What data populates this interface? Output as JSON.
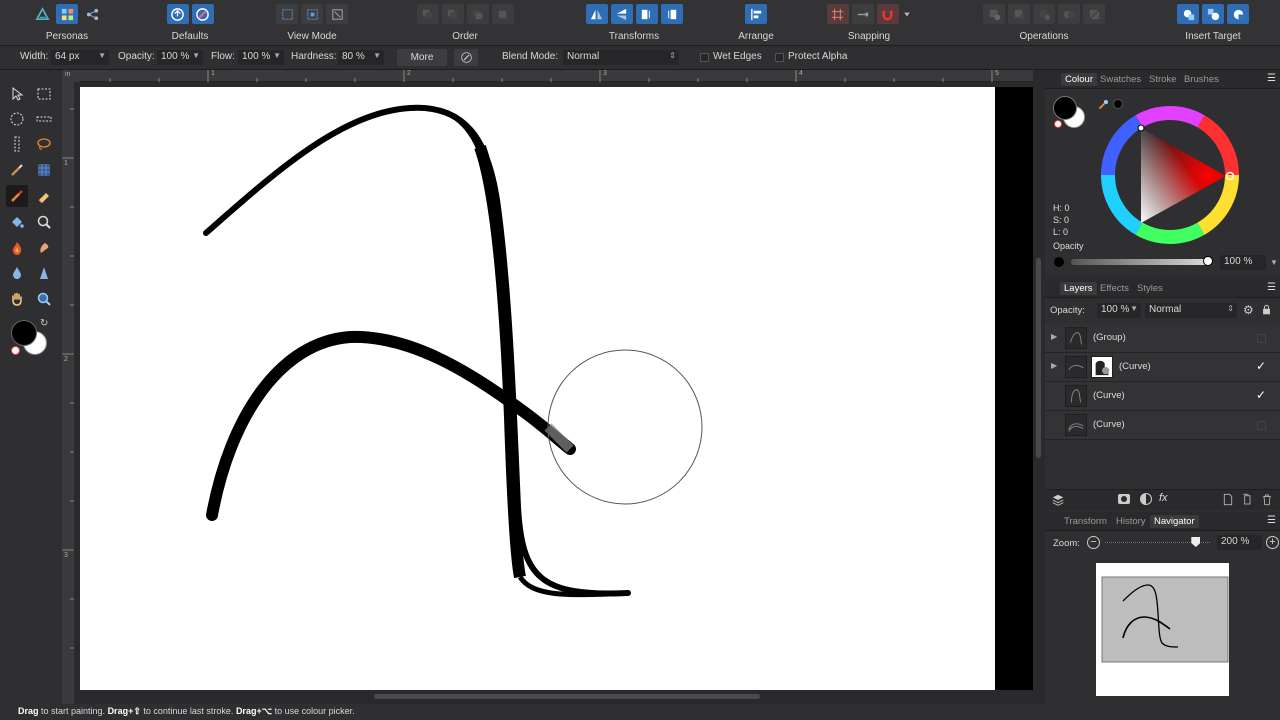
{
  "toolbar": {
    "groups": [
      {
        "label": "Personas"
      },
      {
        "label": "Defaults"
      },
      {
        "label": "View Mode"
      },
      {
        "label": "Order"
      },
      {
        "label": "Transforms"
      },
      {
        "label": "Arrange"
      },
      {
        "label": "Snapping"
      },
      {
        "label": "Operations"
      },
      {
        "label": "Insert Target"
      }
    ]
  },
  "context": {
    "width_label": "Width:",
    "width_value": "64 px",
    "opacity_label": "Opacity:",
    "opacity_value": "100 %",
    "flow_label": "Flow:",
    "flow_value": "100 %",
    "hardness_label": "Hardness:",
    "hardness_value": "80 %",
    "more_label": "More",
    "blend_label": "Blend Mode:",
    "blend_value": "Normal",
    "wet_edges_label": "Wet Edges",
    "protect_alpha_label": "Protect Alpha"
  },
  "rulers": {
    "unit": "in",
    "top_ticks": [
      "1",
      "2",
      "3",
      "4",
      "5"
    ],
    "left_ticks": [
      "1",
      "2",
      "3"
    ]
  },
  "colour_panel": {
    "tabs": [
      "Colour",
      "Swatches",
      "Stroke",
      "Brushes"
    ],
    "active_tab": "Colour",
    "h": "H: 0",
    "s": "S: 0",
    "l": "L: 0",
    "opacity_label": "Opacity",
    "opacity_value": "100 %"
  },
  "layers_panel": {
    "tabs": [
      "Layers",
      "Effects",
      "Styles"
    ],
    "active_tab": "Layers",
    "opacity_label": "Opacity:",
    "opacity_value": "100 %",
    "blend_value": "Normal",
    "layers": [
      {
        "name": "(Group)",
        "expandable": true,
        "visible": false
      },
      {
        "name": "(Curve)",
        "expandable": true,
        "visible": true
      },
      {
        "name": "(Curve)",
        "expandable": false,
        "visible": true
      },
      {
        "name": "(Curve)",
        "expandable": false,
        "visible": false
      }
    ]
  },
  "navigator_panel": {
    "tabs": [
      "Transform",
      "History",
      "Navigator"
    ],
    "active_tab": "Navigator",
    "zoom_label": "Zoom:",
    "zoom_value": "200 %",
    "zoom_fraction": 0.86
  },
  "status": {
    "drag1": "Drag",
    "text1": " to start painting. ",
    "drag2": "Drag+⇧",
    "text2": " to continue last stroke. ",
    "drag3": "Drag+⌥",
    "text3": " to use colour picker."
  },
  "colors": {
    "accent": "#2f6db5",
    "background": "#2d2d2f",
    "canvas": "#ffffff",
    "stroke": "#000000"
  }
}
